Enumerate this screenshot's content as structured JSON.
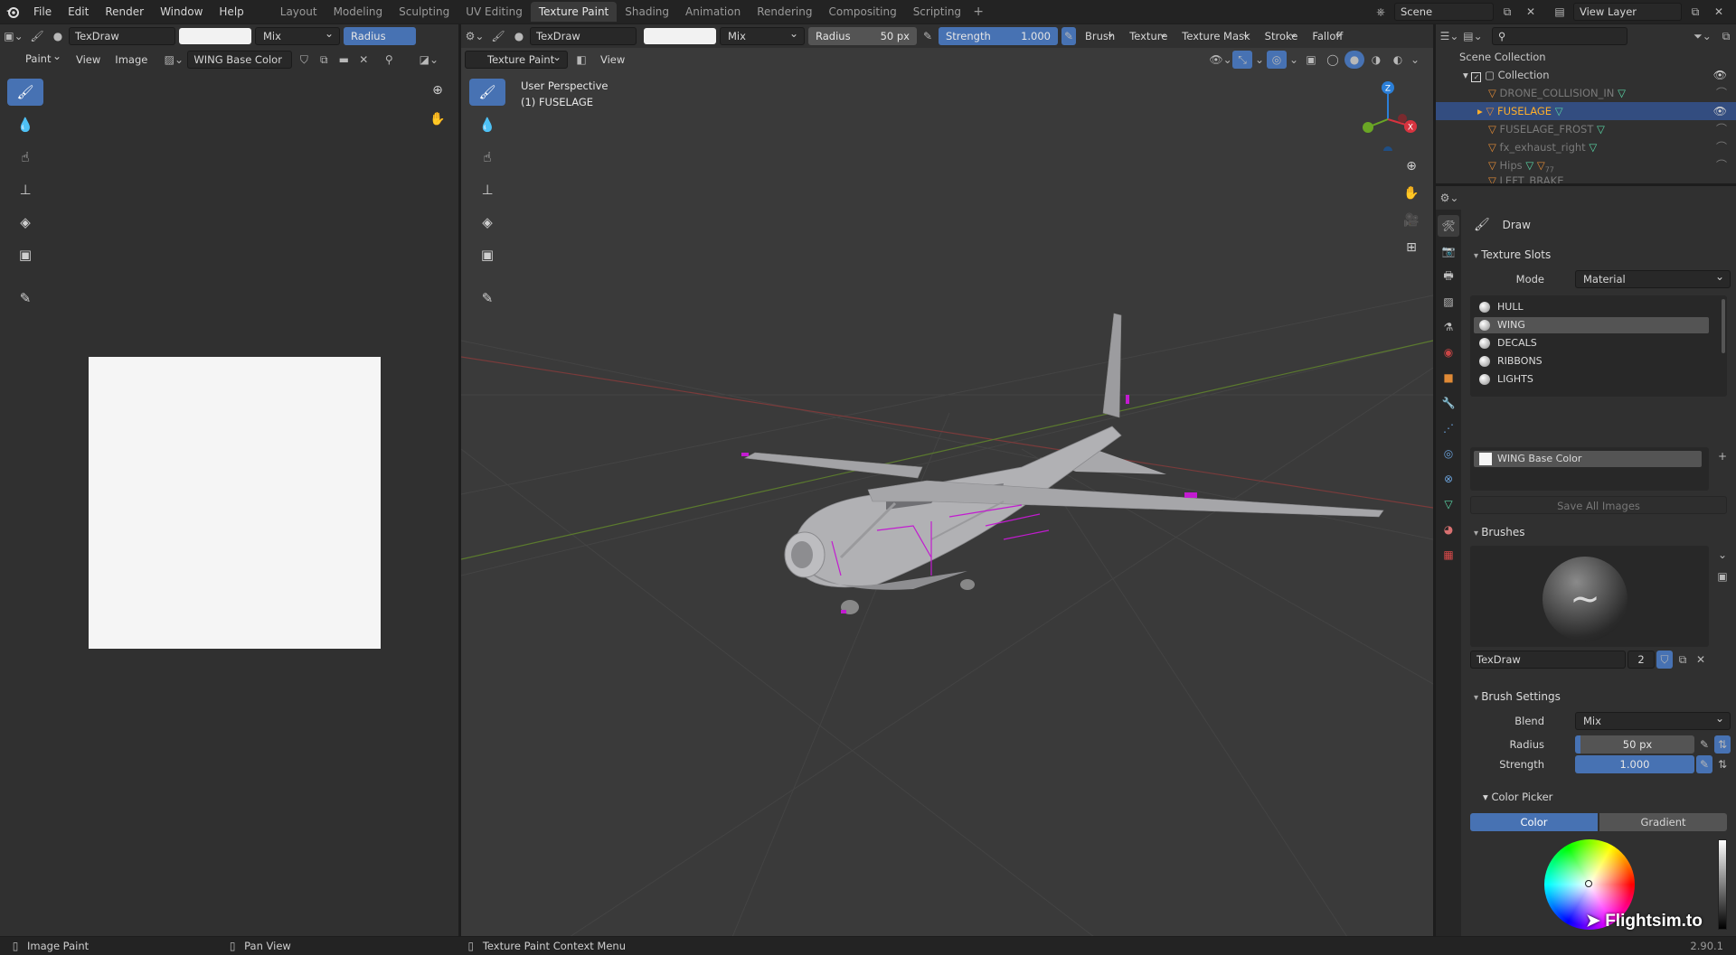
{
  "menu": {
    "file": "File",
    "edit": "Edit",
    "render": "Render",
    "window": "Window",
    "help": "Help"
  },
  "workspaces": [
    "Layout",
    "Modeling",
    "Sculpting",
    "UV Editing",
    "Texture Paint",
    "Shading",
    "Animation",
    "Rendering",
    "Compositing",
    "Scripting"
  ],
  "active_workspace": "Texture Paint",
  "scene": "Scene",
  "view_layer": "View Layer",
  "image_editor": {
    "brush_name": "TexDraw",
    "blend": "Mix",
    "radius_label": "Radius",
    "mode": "Paint",
    "view_menu": "View",
    "image_menu": "Image",
    "image_name": "WING Base Color"
  },
  "viewport": {
    "brush_name": "TexDraw",
    "blend": "Mix",
    "radius_label": "Radius",
    "radius_value": "50 px",
    "strength_label": "Strength",
    "strength_value": "1.000",
    "menus": [
      "Brush",
      "Texture",
      "Texture Mask",
      "Stroke",
      "Falloff"
    ],
    "mode": "Texture Paint",
    "view_menu": "View",
    "overlay_title": "User Perspective",
    "overlay_object": "(1) FUSELAGE",
    "gizmo": {
      "x": "X",
      "y": "Y",
      "z": "Z"
    }
  },
  "outliner": {
    "root": "Scene Collection",
    "collection": "Collection",
    "items": [
      "DRONE_COLLISION_IN",
      "FUSELAGE",
      "FUSELAGE_FROST",
      "fx_exhaust_right",
      "Hips",
      "LEFT_BRAKE"
    ],
    "selected": "FUSELAGE",
    "hips_badge": "77"
  },
  "properties": {
    "tool_name": "Draw",
    "texture_slots": {
      "title": "Texture Slots",
      "mode_label": "Mode",
      "mode_value": "Material",
      "materials": [
        "HULL",
        "WING",
        "DECALS",
        "RIBBONS",
        "LIGHTS"
      ],
      "selected_material": "WING",
      "image": "WING Base Color",
      "save_all": "Save All Images"
    },
    "brushes": {
      "title": "Brushes",
      "brush_name": "TexDraw",
      "users": "2"
    },
    "brush_settings": {
      "title": "Brush Settings",
      "blend_label": "Blend",
      "blend_value": "Mix",
      "radius_label": "Radius",
      "radius_value": "50 px",
      "strength_label": "Strength",
      "strength_value": "1.000",
      "color_picker_title": "Color Picker",
      "color_tab": "Color",
      "gradient_tab": "Gradient"
    }
  },
  "status": {
    "left": "Image Paint",
    "middle": "Pan View",
    "right": "Texture Paint Context Menu",
    "version": "2.90.1"
  },
  "watermark": "Flightsim.to",
  "colors": {
    "accent": "#4772b3",
    "selection": "#334d80",
    "active_object": "#ffaf29",
    "mesh": "#a9a9ab",
    "seam_highlight": "#c21bd0"
  }
}
